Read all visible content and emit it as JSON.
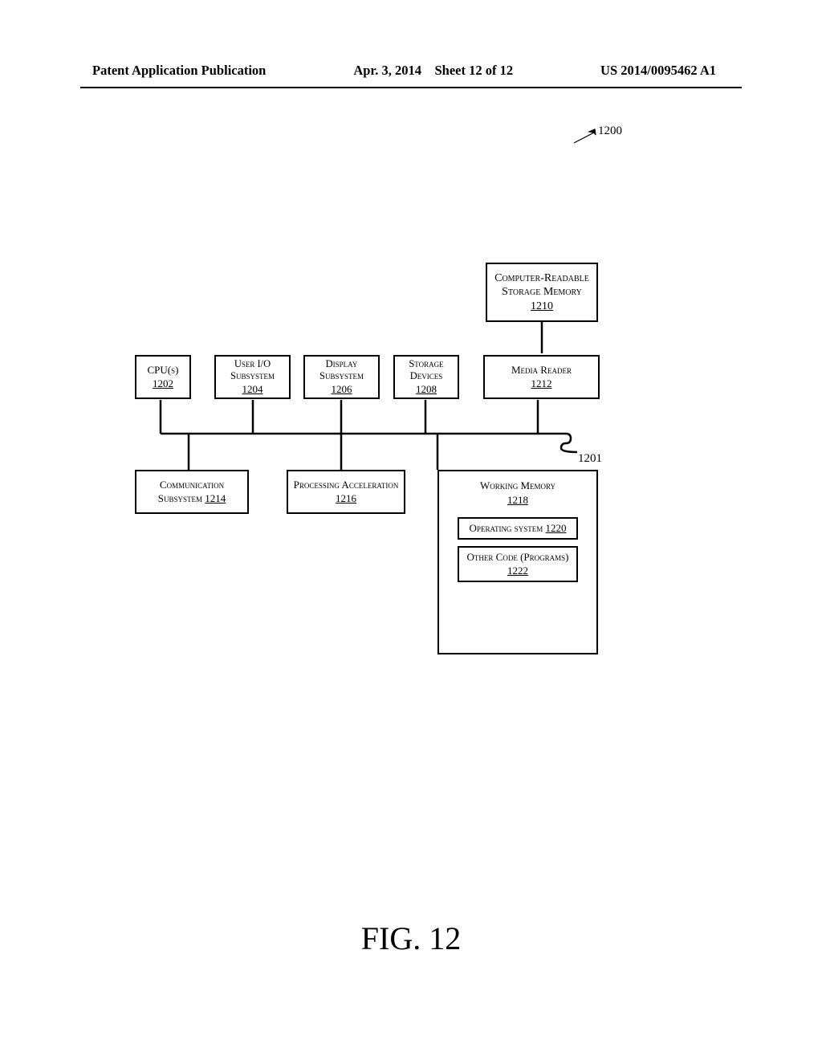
{
  "header": {
    "left": "Patent Application Publication",
    "date": "Apr. 3, 2014",
    "sheet": "Sheet 12 of 12",
    "pubno": "US 2014/0095462 A1"
  },
  "figure_label": "FIG. 12",
  "labels": {
    "fig_ref": "1200",
    "bus_ref": "1201"
  },
  "blocks": {
    "crsm": {
      "label": "Computer-Readable Storage Memory",
      "ref": "1210"
    },
    "cpu": {
      "label": "CPU(s)",
      "ref": "1202"
    },
    "uio": {
      "label": "User I/O Subsystem",
      "ref": "1204"
    },
    "disp": {
      "label": "Display Subsystem",
      "ref": "1206"
    },
    "stor": {
      "label": "Storage Devices",
      "ref": "1208"
    },
    "mread": {
      "label": "Media Reader",
      "ref": "1212"
    },
    "comm": {
      "label": "Communication Subsystem",
      "ref": "1214"
    },
    "paccel": {
      "label": "Processing Acceleration",
      "ref": "1216"
    },
    "wmem": {
      "label": "Working Memory",
      "ref": "1218"
    },
    "os": {
      "label": "Operating system",
      "ref": "1220"
    },
    "other": {
      "label": "Other Code (Programs)",
      "ref": "1222"
    }
  }
}
